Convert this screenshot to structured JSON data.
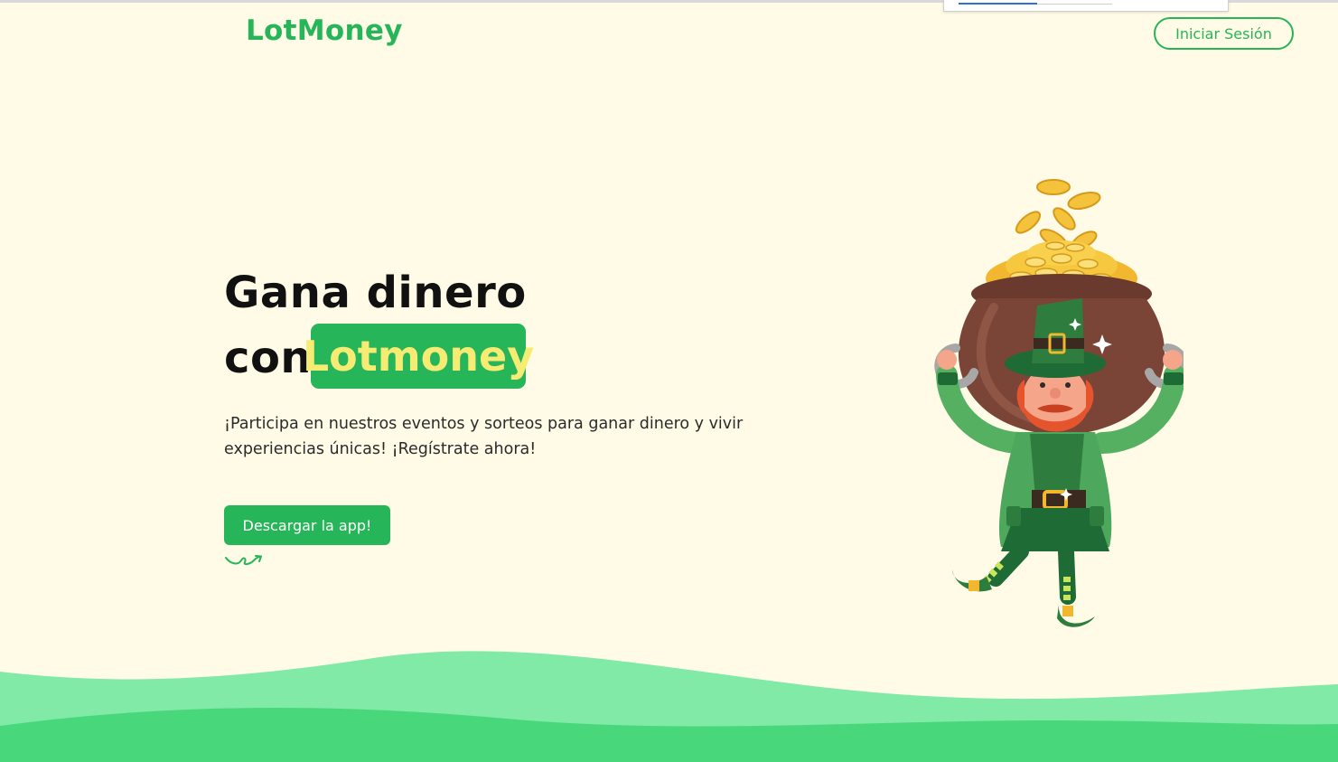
{
  "header": {
    "logo": "LotMoney",
    "login_label": "Iniciar Sesión"
  },
  "hero": {
    "title_line1": "Gana dinero",
    "title_line2_prefix": "con",
    "title_highlight": "Lotmoney",
    "description": "¡Participa en nuestros eventos y sorteos para ganar dinero y vivir experiencias únicas! ¡Regístrate ahora!",
    "cta_label": "Descargar la app!"
  },
  "colors": {
    "brand": "#27b559",
    "highlight_text": "#f6ec74",
    "background": "#fffbe6",
    "wave_light": "#80eaa6",
    "wave_dark": "#48d87b"
  },
  "icons": {
    "squiggle": "squiggle-arrow-icon",
    "illustration": "leprechaun-pot-of-gold-illustration"
  }
}
